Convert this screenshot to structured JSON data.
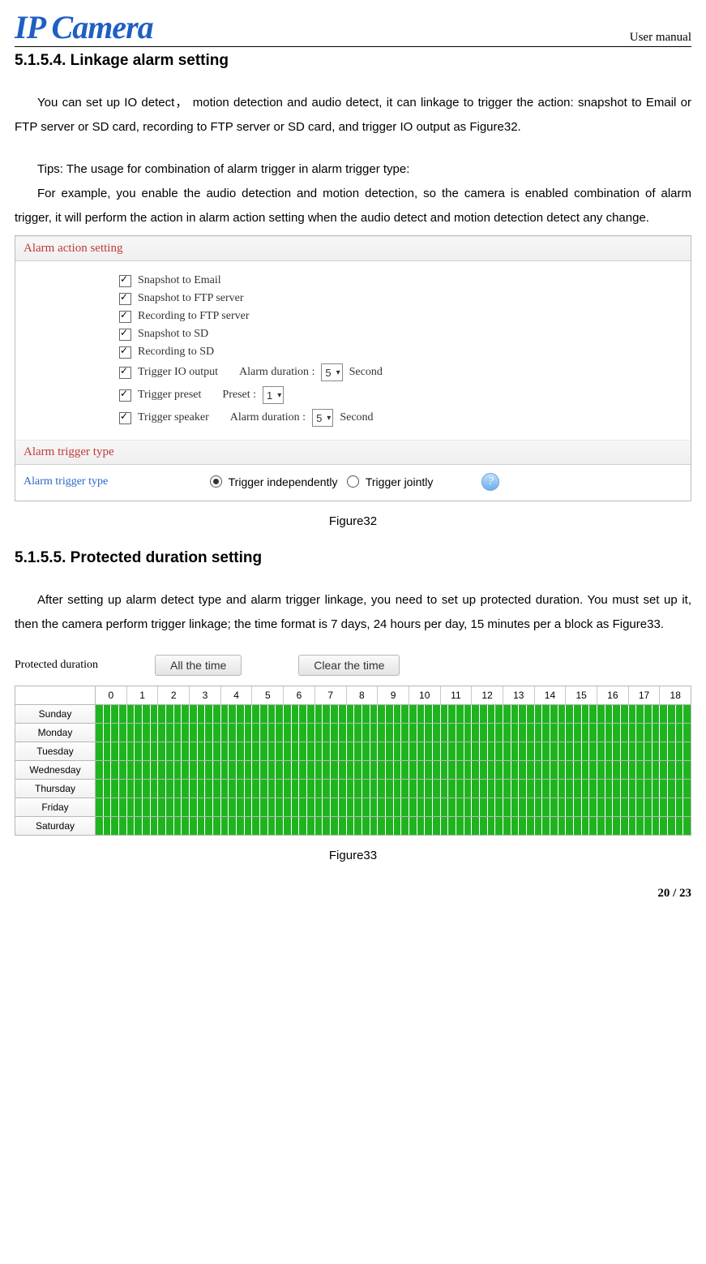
{
  "header": {
    "logo": "IP Camera",
    "right": "User manual"
  },
  "section1": {
    "heading": "5.1.5.4. Linkage alarm setting",
    "para1": "You can set up IO detect，  motion detection and audio detect, it can linkage to trigger the action: snapshot to Email or FTP server or SD card, recording to FTP server or SD card, and trigger IO output as Figure32.",
    "para2a": "Tips: The usage for combination of alarm trigger in alarm trigger type:",
    "para2b": "For example, you enable the audio detection and motion detection, so the camera is enabled combination of alarm trigger, it will perform the action in alarm action setting when the audio detect and motion detection detect any change."
  },
  "figure32": {
    "bar1": "Alarm action setting",
    "items": {
      "a": "Snapshot to Email",
      "b": "Snapshot to FTP server",
      "c": "Recording to FTP server",
      "d": "Snapshot to SD",
      "e": "Recording to SD",
      "f_label": "Trigger IO output",
      "f_dur_lbl": "Alarm duration :",
      "f_dur_val": "5",
      "f_unit": "Second",
      "g_label": "Trigger preset",
      "g_preset_lbl": "Preset :",
      "g_preset_val": "1",
      "h_label": "Trigger speaker",
      "h_dur_lbl": "Alarm duration :",
      "h_dur_val": "5",
      "h_unit": "Second"
    },
    "bar2": "Alarm trigger type",
    "trigger": {
      "label": "Alarm trigger type",
      "opt1": "Trigger independently",
      "opt2": "Trigger jointly"
    },
    "caption": "Figure32"
  },
  "section2": {
    "heading": "5.1.5.5. Protected duration setting",
    "para": "After setting up alarm detect type and alarm trigger linkage, you need to set up protected duration. You must set up it, then the camera perform trigger linkage; the time format is 7 days, 24 hours per day, 15 minutes per a block as Figure33."
  },
  "figure33": {
    "label": "Protected duration",
    "btn1": "All the time",
    "btn2": "Clear the time",
    "hours": [
      "0",
      "1",
      "2",
      "3",
      "4",
      "5",
      "6",
      "7",
      "8",
      "9",
      "10",
      "11",
      "12",
      "13",
      "14",
      "15",
      "16",
      "17",
      "18"
    ],
    "days": [
      "Sunday",
      "Monday",
      "Tuesday",
      "Wednesday",
      "Thursday",
      "Friday",
      "Saturday"
    ],
    "caption": "Figure33"
  },
  "footer": {
    "page": "20 / 23"
  }
}
